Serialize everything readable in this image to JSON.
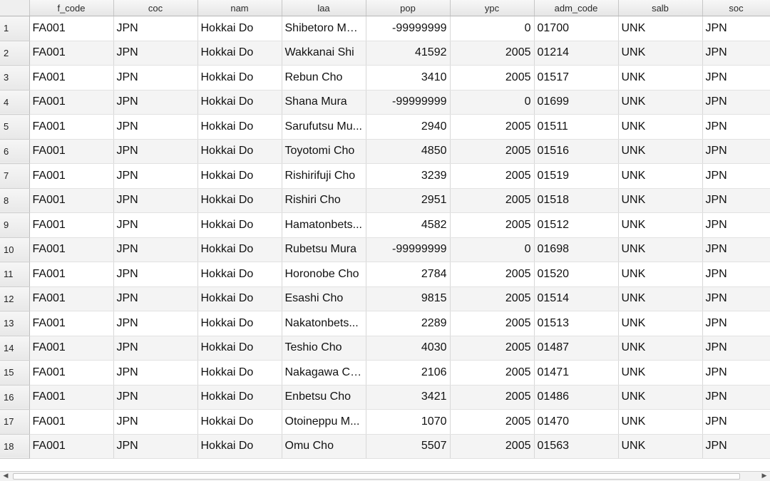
{
  "table": {
    "columns": [
      "f_code",
      "coc",
      "nam",
      "laa",
      "pop",
      "ypc",
      "adm_code",
      "salb",
      "soc"
    ],
    "rows": [
      {
        "num": "1",
        "cells": [
          "FA001",
          "JPN",
          "Hokkai Do",
          "Shibetoro Mura",
          "-99999999",
          "0",
          "01700",
          "UNK",
          "JPN"
        ]
      },
      {
        "num": "2",
        "cells": [
          "FA001",
          "JPN",
          "Hokkai Do",
          "Wakkanai Shi",
          "41592",
          "2005",
          "01214",
          "UNK",
          "JPN"
        ]
      },
      {
        "num": "3",
        "cells": [
          "FA001",
          "JPN",
          "Hokkai Do",
          "Rebun Cho",
          "3410",
          "2005",
          "01517",
          "UNK",
          "JPN"
        ]
      },
      {
        "num": "4",
        "cells": [
          "FA001",
          "JPN",
          "Hokkai Do",
          "Shana Mura",
          "-99999999",
          "0",
          "01699",
          "UNK",
          "JPN"
        ]
      },
      {
        "num": "5",
        "cells": [
          "FA001",
          "JPN",
          "Hokkai Do",
          "Sarufutsu Mu...",
          "2940",
          "2005",
          "01511",
          "UNK",
          "JPN"
        ]
      },
      {
        "num": "6",
        "cells": [
          "FA001",
          "JPN",
          "Hokkai Do",
          "Toyotomi Cho",
          "4850",
          "2005",
          "01516",
          "UNK",
          "JPN"
        ]
      },
      {
        "num": "7",
        "cells": [
          "FA001",
          "JPN",
          "Hokkai Do",
          "Rishirifuji Cho",
          "3239",
          "2005",
          "01519",
          "UNK",
          "JPN"
        ]
      },
      {
        "num": "8",
        "cells": [
          "FA001",
          "JPN",
          "Hokkai Do",
          "Rishiri Cho",
          "2951",
          "2005",
          "01518",
          "UNK",
          "JPN"
        ]
      },
      {
        "num": "9",
        "cells": [
          "FA001",
          "JPN",
          "Hokkai Do",
          "Hamatonbets...",
          "4582",
          "2005",
          "01512",
          "UNK",
          "JPN"
        ]
      },
      {
        "num": "10",
        "cells": [
          "FA001",
          "JPN",
          "Hokkai Do",
          "Rubetsu Mura",
          "-99999999",
          "0",
          "01698",
          "UNK",
          "JPN"
        ]
      },
      {
        "num": "11",
        "cells": [
          "FA001",
          "JPN",
          "Hokkai Do",
          "Horonobe Cho",
          "2784",
          "2005",
          "01520",
          "UNK",
          "JPN"
        ]
      },
      {
        "num": "12",
        "cells": [
          "FA001",
          "JPN",
          "Hokkai Do",
          "Esashi Cho",
          "9815",
          "2005",
          "01514",
          "UNK",
          "JPN"
        ]
      },
      {
        "num": "13",
        "cells": [
          "FA001",
          "JPN",
          "Hokkai Do",
          "Nakatonbets...",
          "2289",
          "2005",
          "01513",
          "UNK",
          "JPN"
        ]
      },
      {
        "num": "14",
        "cells": [
          "FA001",
          "JPN",
          "Hokkai Do",
          "Teshio Cho",
          "4030",
          "2005",
          "01487",
          "UNK",
          "JPN"
        ]
      },
      {
        "num": "15",
        "cells": [
          "FA001",
          "JPN",
          "Hokkai Do",
          "Nakagawa Cho",
          "2106",
          "2005",
          "01471",
          "UNK",
          "JPN"
        ]
      },
      {
        "num": "16",
        "cells": [
          "FA001",
          "JPN",
          "Hokkai Do",
          "Enbetsu Cho",
          "3421",
          "2005",
          "01486",
          "UNK",
          "JPN"
        ]
      },
      {
        "num": "17",
        "cells": [
          "FA001",
          "JPN",
          "Hokkai Do",
          "Otoineppu M...",
          "1070",
          "2005",
          "01470",
          "UNK",
          "JPN"
        ]
      },
      {
        "num": "18",
        "cells": [
          "FA001",
          "JPN",
          "Hokkai Do",
          "Omu Cho",
          "5507",
          "2005",
          "01563",
          "UNK",
          "JPN"
        ]
      }
    ],
    "numeric_columns": [
      4,
      5
    ]
  },
  "scrollbar": {
    "left_arrow": "◀",
    "right_arrow": "▶"
  }
}
